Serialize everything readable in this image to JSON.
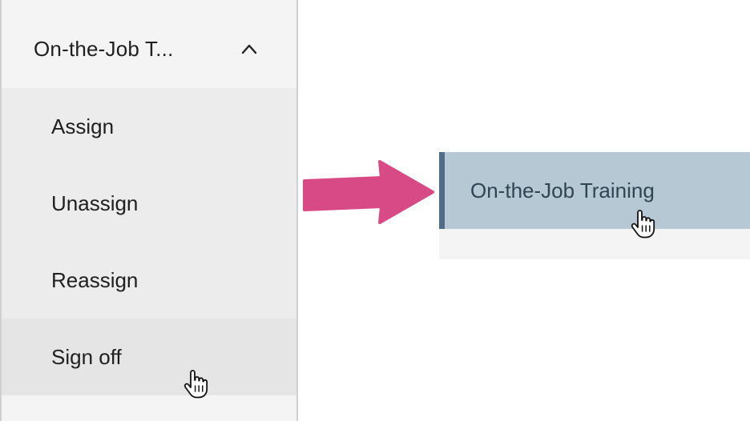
{
  "sidebar": {
    "group": {
      "label": "On-the-Job T...",
      "expanded": true,
      "chevron_icon": "chevron-up-icon"
    },
    "items": [
      {
        "label": "Assign"
      },
      {
        "label": "Unassign"
      },
      {
        "label": "Reassign"
      },
      {
        "label": "Sign off",
        "hovered": true
      }
    ]
  },
  "collapsed_menu": {
    "label": "On-the-Job Training",
    "accent_color": "#4f6d86",
    "background_color": "#b5c8d4"
  },
  "annotation": {
    "arrow_icon": "right-arrow-icon",
    "arrow_color": "#d84a86",
    "cursor_icon": "hand-pointer-icon"
  }
}
